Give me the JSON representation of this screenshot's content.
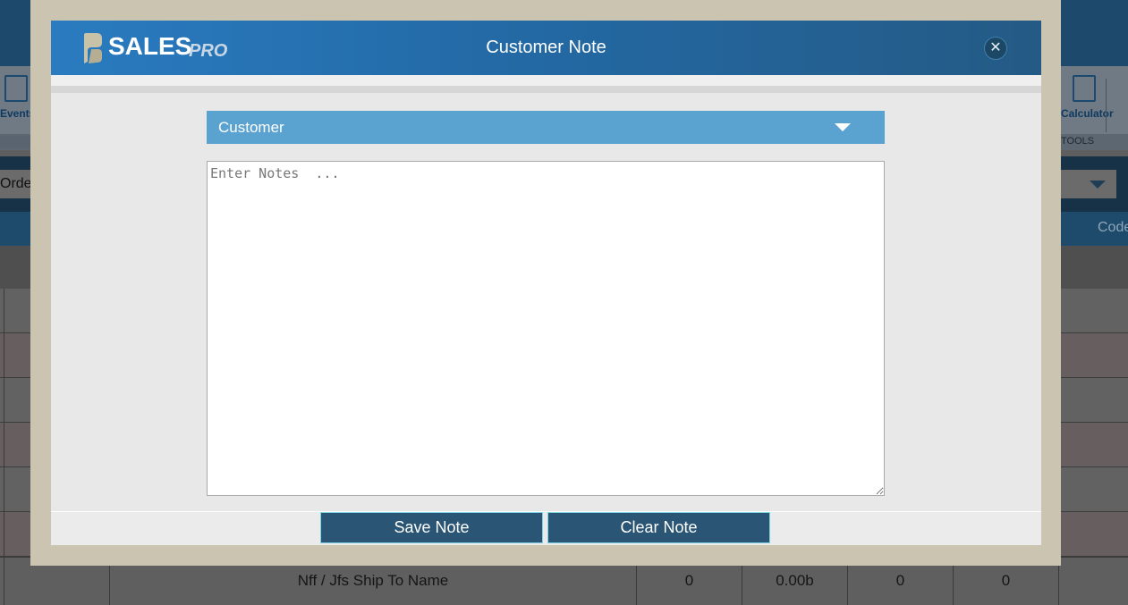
{
  "background": {
    "ribbon": {
      "events_label": "Events",
      "calculator_label": "Calculator",
      "tools_label": "TOOLS"
    },
    "order_field_value": "Order",
    "column_code_label": "Code",
    "last_row": {
      "name": "Nff / Jfs Ship To Name",
      "col2": "0",
      "col3": "0.00b",
      "col4": "0",
      "col5": "0"
    }
  },
  "modal": {
    "logo": {
      "sales": "SALES",
      "pro": "PRO"
    },
    "title": "Customer Note",
    "close_icon": "close-icon",
    "customer_select": {
      "selected": "Customer"
    },
    "notes": {
      "placeholder": "Enter Notes  ...",
      "value": ""
    },
    "buttons": {
      "save": "Save Note",
      "clear": "Clear Note"
    }
  },
  "colors": {
    "header_start": "#2a7bc0",
    "header_end": "#245a85",
    "select_bg": "#5aa2d0",
    "button_bg": "#2a5574",
    "button_border": "#7fd3e3",
    "frame": "#cbc4b0"
  }
}
